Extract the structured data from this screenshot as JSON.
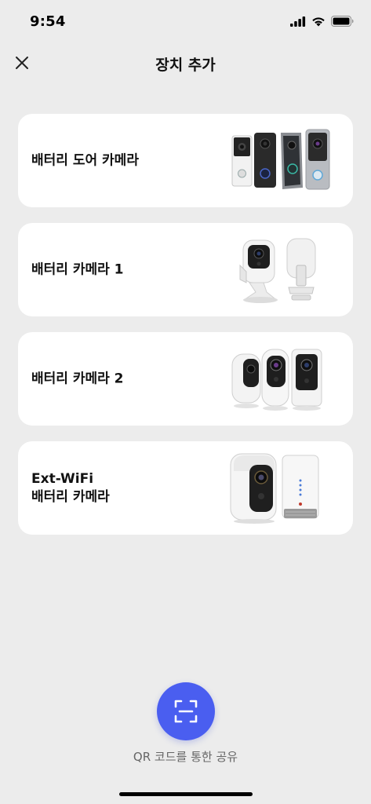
{
  "status_bar": {
    "time": "9:54",
    "icons": [
      "cellular-signal-icon",
      "wifi-icon",
      "battery-icon"
    ]
  },
  "header": {
    "title": "장치 추가",
    "close_icon": "close-icon"
  },
  "devices": [
    {
      "lines": [
        "배터리 도어 카메라"
      ],
      "image": "doorbell-cameras-image"
    },
    {
      "lines": [
        "배터리 카메라 1"
      ],
      "image": "battery-camera-1-image"
    },
    {
      "lines": [
        "배터리 카메라 2"
      ],
      "image": "battery-camera-2-image"
    },
    {
      "lines": [
        "Ext-WiFi",
        "배터리 카메라"
      ],
      "image": "ext-wifi-camera-image"
    }
  ],
  "qr": {
    "label": "QR 코드를 통한 공유",
    "icon": "qr-scan-icon",
    "button_color": "#4a5ef0"
  },
  "colors": {
    "background": "#ececec",
    "card": "#ffffff",
    "accent": "#4a5ef0"
  }
}
